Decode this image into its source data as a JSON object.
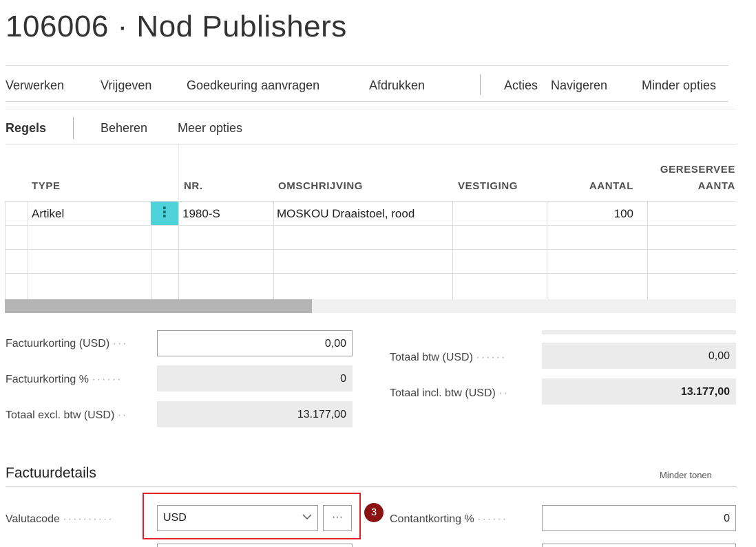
{
  "page": {
    "title": "106006 · Nod Publishers"
  },
  "menu": {
    "items": [
      "Verwerken",
      "Vrijgeven",
      "Goedkeuring aanvragen",
      "Afdrukken",
      "Acties",
      "Navigeren",
      "Minder opties"
    ]
  },
  "lines": {
    "subtabs": [
      "Regels",
      "Beheren",
      "Meer opties"
    ],
    "columns": {
      "type": "TYPE",
      "nr": "NR.",
      "omschrijving": "OMSCHRIJVING",
      "vestiging": "VESTIGING",
      "aantal": "AANTAL",
      "gereserveerd_1": "GERESERVEE",
      "gereserveerd_2": "AANTA"
    },
    "rows": [
      {
        "type": "Artikel",
        "nr": "1980-S",
        "omschrijving": "MOSKOU Draaistoel, rood",
        "vestiging": "",
        "aantal": "100",
        "gereserveerd": ""
      }
    ],
    "row_menu_icon": "vertical-ellipsis-icon",
    "scroll_position": 0.42
  },
  "totals": {
    "left": [
      {
        "label": "Factuurkorting (USD)",
        "value": "0,00",
        "editable": true
      },
      {
        "label": "Factuurkorting %",
        "value": "0",
        "editable": false
      },
      {
        "label": "Totaal excl. btw (USD)",
        "value": "13.177,00",
        "editable": false
      }
    ],
    "right": [
      {
        "label": "Totaal btw (USD)",
        "value": "0,00"
      },
      {
        "label": "Totaal incl. btw (USD)",
        "value": "13.177,00"
      }
    ]
  },
  "invoice_details": {
    "title": "Factuurdetails",
    "toggle_link": "Minder tonen",
    "valuta": {
      "label": "Valutacode",
      "value": "USD",
      "more_button": "···"
    },
    "contantkorting": {
      "label": "Contantkorting %",
      "value": "0"
    },
    "callout_number": "3"
  },
  "colors": {
    "accent_cell": "#4fd2d9",
    "callout_border": "#e02020",
    "callout_badge": "#8b1212",
    "readonly_bg": "#ebebeb"
  }
}
